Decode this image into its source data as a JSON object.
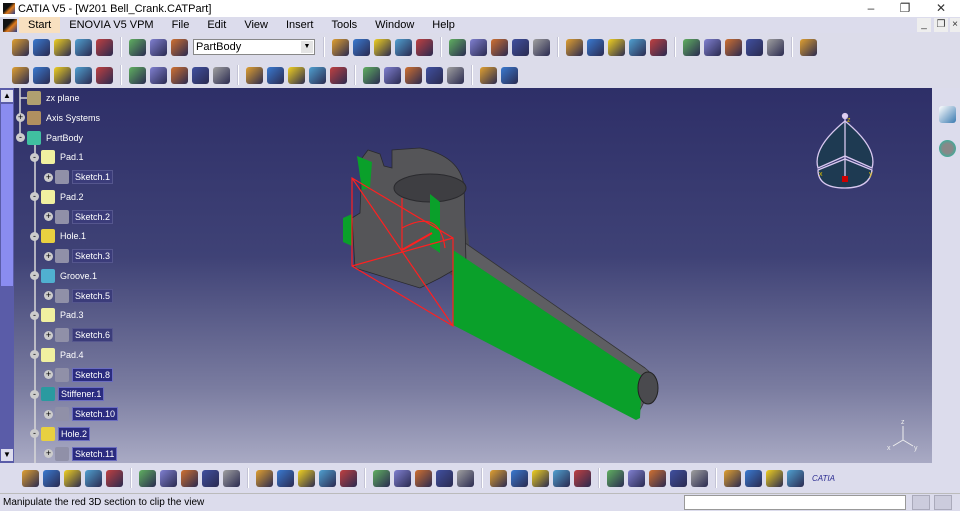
{
  "window": {
    "title": "CATIA V5 - [W201 Bell_Crank.CATPart]",
    "controls": [
      "minimize",
      "restore",
      "close"
    ]
  },
  "menu": {
    "items": [
      "Start",
      "ENOVIA V5 VPM",
      "File",
      "Edit",
      "View",
      "Insert",
      "Tools",
      "Window",
      "Help"
    ],
    "active": "Start"
  },
  "toolbar1": {
    "icons_left": [
      "spin-icon",
      "fly-mode-icon",
      "axis-icon",
      "units-icon",
      "body-icon",
      "knowledge-icon",
      "list-icon",
      "cube-icon"
    ],
    "combo_value": "PartBody",
    "icons_right": [
      "pad-icon",
      "pocket-icon",
      "shaft-icon",
      "groove-icon",
      "hole-icon",
      "rib-icon",
      "slot-icon",
      "sketch-icon",
      "fillet-icon",
      "shell-icon",
      "thickness-icon",
      "draft-icon",
      "chamfer-icon",
      "edge-fillet-icon",
      "translate-icon",
      "pattern-icon",
      "select-icon",
      "hide-show-icon",
      "swap-icon",
      "grid-icon",
      "snap-icon"
    ]
  },
  "toolbar2": {
    "icons": [
      "formula-icon",
      "comment-icon",
      "lock-small-icon",
      "table-icon",
      "tree-icon",
      "lock-icon",
      "parameters-icon",
      "point-icon",
      "line-icon",
      "plane-icon",
      "analysis-icon",
      "measure-icon",
      "catalog-icon",
      "split-icon",
      "thick-surface-icon",
      "close-surface-icon",
      "sew-surface-icon",
      "assemble-icon",
      "add-body-icon",
      "remove-icon",
      "intersect-icon",
      "material-icon"
    ]
  },
  "tree": {
    "items": [
      {
        "label": "zx plane",
        "level": 1,
        "icon": "plane-icon",
        "expander": "",
        "style": ""
      },
      {
        "label": "Axis Systems",
        "level": 1,
        "icon": "axis-icon",
        "expander": "+",
        "style": ""
      },
      {
        "label": "PartBody",
        "level": 1,
        "icon": "partbody-icon",
        "expander": "-",
        "style": ""
      },
      {
        "label": "Pad.1",
        "level": 2,
        "icon": "pad-icon",
        "expander": "-",
        "style": ""
      },
      {
        "label": "Sketch.1",
        "level": 3,
        "icon": "sketch-icon",
        "expander": "+",
        "style": "box"
      },
      {
        "label": "Pad.2",
        "level": 2,
        "icon": "pad-icon",
        "expander": "-",
        "style": ""
      },
      {
        "label": "Sketch.2",
        "level": 3,
        "icon": "sketch-icon",
        "expander": "+",
        "style": "box"
      },
      {
        "label": "Hole.1",
        "level": 2,
        "icon": "hole-icon",
        "expander": "-",
        "style": ""
      },
      {
        "label": "Sketch.3",
        "level": 3,
        "icon": "sketch-icon",
        "expander": "+",
        "style": "box"
      },
      {
        "label": "Groove.1",
        "level": 2,
        "icon": "groove-icon",
        "expander": "-",
        "style": ""
      },
      {
        "label": "Sketch.5",
        "level": 3,
        "icon": "sketch-icon",
        "expander": "+",
        "style": "box"
      },
      {
        "label": "Pad.3",
        "level": 2,
        "icon": "pad-icon",
        "expander": "-",
        "style": ""
      },
      {
        "label": "Sketch.6",
        "level": 3,
        "icon": "sketch-icon",
        "expander": "+",
        "style": "box"
      },
      {
        "label": "Pad.4",
        "level": 2,
        "icon": "pad-icon",
        "expander": "-",
        "style": ""
      },
      {
        "label": "Sketch.8",
        "level": 3,
        "icon": "sketch-icon",
        "expander": "+",
        "style": "sel"
      },
      {
        "label": "Stiffener.1",
        "level": 2,
        "icon": "stiffener-icon",
        "expander": "-",
        "style": "sel"
      },
      {
        "label": "Sketch.10",
        "level": 3,
        "icon": "sketch-icon",
        "expander": "+",
        "style": "sel"
      },
      {
        "label": "Hole.2",
        "level": 2,
        "icon": "hole-icon",
        "expander": "-",
        "style": "sel"
      },
      {
        "label": "Sketch.11",
        "level": 3,
        "icon": "sketch-icon",
        "expander": "+",
        "style": "sel"
      }
    ]
  },
  "compass": {
    "labels": [
      "z",
      "x",
      "y"
    ]
  },
  "axis_triad": {
    "labels": [
      "z",
      "x",
      "y"
    ]
  },
  "rightbar": {
    "icons": [
      "sketcher-icon",
      "settings-gear-icon"
    ]
  },
  "bottom_toolbar": {
    "icons": [
      "fly-icon",
      "sketch-edit-icon",
      "sketch-tools-icon",
      "new-icon",
      "open-icon",
      "save-icon",
      "print-icon",
      "cut-icon",
      "copy-icon",
      "paste-icon",
      "undo-icon",
      "redo-icon",
      "whats-this-icon",
      "update-icon",
      "capture-icon",
      "measure-between-icon",
      "measure-item-icon",
      "inertia-icon",
      "fit-all-icon",
      "fit-in-icon",
      "pan-icon",
      "rotate-icon",
      "zoom-in-icon",
      "zoom-out-icon",
      "normal-view-icon",
      "multi-view-icon",
      "isometric-view-icon",
      "render-style-icon",
      "hide-show-icon",
      "swap-space-icon",
      "apply-material-icon",
      "shading-icon",
      "texture-icon",
      "material-library-icon"
    ],
    "brand": "CATIA"
  },
  "status": {
    "message": "Manipulate the red 3D section to clip the view",
    "command_input": ""
  },
  "colors": {
    "section": "#ff2020",
    "cut_face": "#0aa02a",
    "model": "#5a5a5e",
    "viewport_top": "#2e2f68",
    "viewport_bottom": "#a9aac4"
  }
}
